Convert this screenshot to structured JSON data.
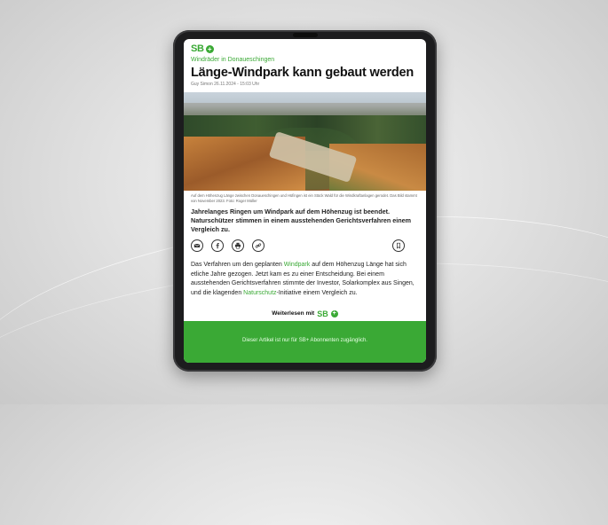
{
  "brand": {
    "logo_text": "SB",
    "logo_plus": "+",
    "accent_color": "#3aa935"
  },
  "article": {
    "kicker": "Windräder in Donaueschingen",
    "headline": "Länge-Windpark kann gebaut werden",
    "byline": "Guy Simon 26.11.2024 - 15:03 Uhr",
    "caption": "Auf dem Höhenzug Länge zwischen Donaueschingen und Hüfingen ist ein Stück Wald für die Windkraftanlagen gerodet. Das Bild stammt von November 2023. Foto: Roger Müller",
    "lead": "Jahrelanges Ringen um Windpark auf dem Höhenzug ist beendet. Naturschützer stimmen in einem ausstehenden Gerichtsverfahren einem Vergleich zu.",
    "body_1": "Das Verfahren um den geplanten ",
    "body_link": "Windpark",
    "body_2": " auf dem Höhenzug Länge hat sich etliche Jahre gezogen. Jetzt kam es zu einer Entscheidung. Bei einem ausstehenden Gerichtsverfahren stimmte der Investor, Solarkomplex aus Singen, und die klagenden ",
    "body_link2": "Naturschutz",
    "body_3": "-Initiative einem Vergleich zu."
  },
  "share_icons": [
    "mail-icon",
    "facebook-icon",
    "print-icon",
    "link-icon",
    "bookmark-icon"
  ],
  "paywall": {
    "cta_label": "Weiterlesen mit",
    "cta_logo": "SB",
    "cta_plus": "+",
    "note": "Dieser Artikel ist nur für SB+ Abonnenten zugänglich."
  }
}
